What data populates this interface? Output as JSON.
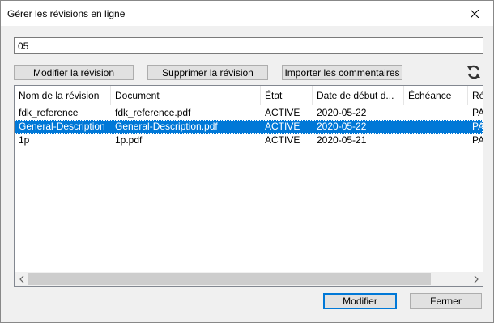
{
  "window": {
    "title": "Gérer les révisions en ligne",
    "close_icon": "close-icon"
  },
  "search": {
    "value": "05"
  },
  "toolbar": {
    "modify_revision": "Modifier la révision",
    "delete_revision": "Supprimer la révision",
    "import_comments": "Importer les commentaires",
    "refresh_icon": "refresh-icon"
  },
  "table": {
    "columns": [
      "Nom de la révision",
      "Document",
      "État",
      "Date de début d...",
      "Échéance",
      "Ré"
    ],
    "rows": [
      {
        "name": "fdk_reference",
        "document": "fdk_reference.pdf",
        "state": "ACTIVE",
        "start": "2020-05-22",
        "due": "",
        "extra": "PA",
        "selected": false
      },
      {
        "name": "General-Description",
        "document": "General-Description.pdf",
        "state": "ACTIVE",
        "start": "2020-05-22",
        "due": "",
        "extra": "PA",
        "selected": true
      },
      {
        "name": "1p",
        "document": "1p.pdf",
        "state": "ACTIVE",
        "start": "2020-05-21",
        "due": "",
        "extra": "PA",
        "selected": false
      }
    ]
  },
  "footer": {
    "modify": "Modifier",
    "close": "Fermer"
  },
  "colors": {
    "selection": "#0078d7",
    "button_face": "#e1e1e1",
    "dialog_bg": "#f0f0f0"
  }
}
